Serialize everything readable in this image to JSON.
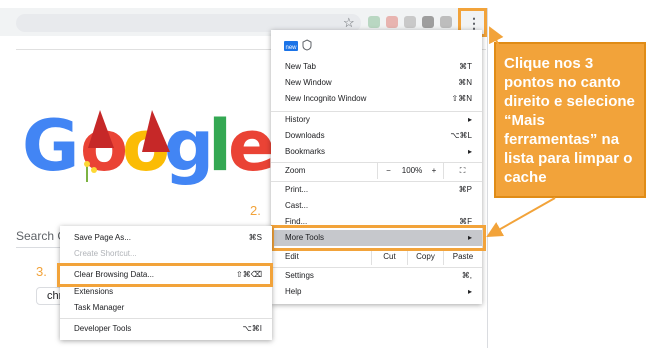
{
  "browser": {
    "star_icon": "star-icon",
    "menu_icon": "three-dots-vertical-icon",
    "search_label": "Search G",
    "chip_label": "chr"
  },
  "colors": {
    "highlight": "#f2a33a",
    "callout_bg": "#f2a33a",
    "menu_hover": "#c6c8cc"
  },
  "steps": {
    "step2": "2.",
    "step3": "3."
  },
  "main_menu": {
    "new_badge": "new",
    "items": [
      {
        "label": "New Tab",
        "shortcut": "⌘T"
      },
      {
        "label": "New Window",
        "shortcut": "⌘N"
      },
      {
        "label": "New Incognito Window",
        "shortcut": "⇧⌘N"
      },
      {
        "label": "History",
        "shortcut": "▸"
      },
      {
        "label": "Downloads",
        "shortcut": "⌥⌘L"
      },
      {
        "label": "Bookmarks",
        "shortcut": "▸"
      },
      {
        "label": "Print...",
        "shortcut": "⌘P"
      },
      {
        "label": "Cast...",
        "shortcut": ""
      },
      {
        "label": "Find...",
        "shortcut": "⌘F"
      },
      {
        "label": "More Tools",
        "shortcut": "▸"
      },
      {
        "label": "Settings",
        "shortcut": "⌘,"
      },
      {
        "label": "Help",
        "shortcut": "▸"
      }
    ],
    "zoom": {
      "label": "Zoom",
      "minus": "−",
      "value": "100%",
      "plus": "+",
      "fullscreen": "⛶"
    },
    "edit": {
      "label": "Edit",
      "cut": "Cut",
      "copy": "Copy",
      "paste": "Paste"
    }
  },
  "sub_menu": {
    "items": [
      {
        "label": "Save Page As...",
        "shortcut": "⌘S"
      },
      {
        "label": "Create Shortcut...",
        "shortcut": ""
      },
      {
        "label": "Clear Browsing Data...",
        "shortcut": "⇧⌘⌫"
      },
      {
        "label": "Extensions",
        "shortcut": ""
      },
      {
        "label": "Task Manager",
        "shortcut": ""
      },
      {
        "label": "Developer Tools",
        "shortcut": "⌥⌘I"
      }
    ]
  },
  "callout": {
    "text": "Clique nos 3 pontos no canto direito e selecione “Mais ferramentas” na lista para limpar o cache"
  },
  "doodle": {
    "letters": [
      "G",
      "o",
      "o",
      "g",
      "l",
      "e"
    ]
  }
}
